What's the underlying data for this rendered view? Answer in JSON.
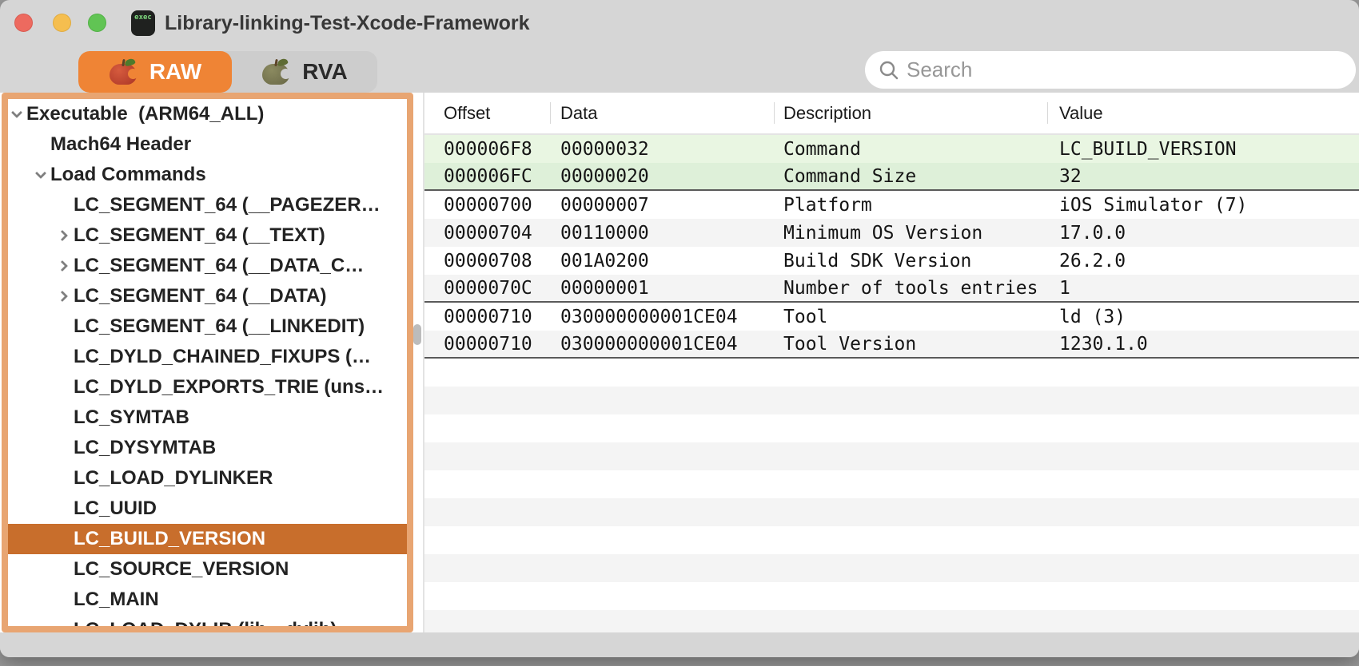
{
  "window": {
    "title": "Library-linking-Test-Xcode-Framework",
    "app_icon_text": "exec",
    "traffic_lights": [
      {
        "name": "close-button",
        "color": "#ED6A5F"
      },
      {
        "name": "minimize-button",
        "color": "#F5BE4F"
      },
      {
        "name": "zoom-button",
        "color": "#61C454"
      }
    ]
  },
  "toolbar": {
    "tabs": [
      {
        "label": "RAW",
        "icon": "apple-red-icon",
        "selected": true
      },
      {
        "label": "RVA",
        "icon": "apple-olive-icon",
        "selected": false
      }
    ],
    "search": {
      "placeholder": "Search",
      "value": ""
    }
  },
  "sidebar": {
    "items": [
      {
        "label": "Executable  (ARM64_ALL)",
        "level": 0,
        "disclosure": "open",
        "selected": false
      },
      {
        "label": "Mach64 Header",
        "level": 1,
        "disclosure": null,
        "selected": false
      },
      {
        "label": "Load Commands",
        "level": 1,
        "disclosure": "open",
        "selected": false
      },
      {
        "label": "LC_SEGMENT_64 (__PAGEZER…",
        "level": 2,
        "disclosure": null,
        "selected": false
      },
      {
        "label": "LC_SEGMENT_64 (__TEXT)",
        "level": 2,
        "disclosure": "closed",
        "selected": false
      },
      {
        "label": "LC_SEGMENT_64 (__DATA_C…",
        "level": 2,
        "disclosure": "closed",
        "selected": false
      },
      {
        "label": "LC_SEGMENT_64 (__DATA)",
        "level": 2,
        "disclosure": "closed",
        "selected": false
      },
      {
        "label": "LC_SEGMENT_64 (__LINKEDIT)",
        "level": 2,
        "disclosure": null,
        "selected": false
      },
      {
        "label": "LC_DYLD_CHAINED_FIXUPS (…",
        "level": 2,
        "disclosure": null,
        "selected": false
      },
      {
        "label": "LC_DYLD_EXPORTS_TRIE (uns…",
        "level": 2,
        "disclosure": null,
        "selected": false
      },
      {
        "label": "LC_SYMTAB",
        "level": 2,
        "disclosure": null,
        "selected": false
      },
      {
        "label": "LC_DYSYMTAB",
        "level": 2,
        "disclosure": null,
        "selected": false
      },
      {
        "label": "LC_LOAD_DYLINKER",
        "level": 2,
        "disclosure": null,
        "selected": false
      },
      {
        "label": "LC_UUID",
        "level": 2,
        "disclosure": null,
        "selected": false
      },
      {
        "label": "LC_BUILD_VERSION",
        "level": 2,
        "disclosure": null,
        "selected": true
      },
      {
        "label": "LC_SOURCE_VERSION",
        "level": 2,
        "disclosure": null,
        "selected": false
      },
      {
        "label": "LC_MAIN",
        "level": 2,
        "disclosure": null,
        "selected": false
      },
      {
        "label": "LC_LOAD_DYLIB (lib…dylib)",
        "level": 2,
        "disclosure": null,
        "selected": false,
        "clipped": true
      }
    ]
  },
  "table": {
    "columns": [
      "Offset",
      "Data",
      "Description",
      "Value"
    ],
    "rows": [
      {
        "offset": "000006F8",
        "data": "00000032",
        "description": "Command",
        "value": "LC_BUILD_VERSION",
        "tint": "green",
        "sep": false
      },
      {
        "offset": "000006FC",
        "data": "00000020",
        "description": "Command Size",
        "value": "32",
        "tint": "green",
        "sep": true
      },
      {
        "offset": "00000700",
        "data": "00000007",
        "description": "Platform",
        "value": "iOS Simulator (7)",
        "tint": null,
        "sep": false
      },
      {
        "offset": "00000704",
        "data": "00110000",
        "description": "Minimum OS Version",
        "value": "17.0.0",
        "tint": null,
        "sep": false
      },
      {
        "offset": "00000708",
        "data": "001A0200",
        "description": "Build SDK Version",
        "value": "26.2.0",
        "tint": null,
        "sep": false
      },
      {
        "offset": "0000070C",
        "data": "00000001",
        "description": "Number of tools entries",
        "value": "1",
        "tint": null,
        "sep": true
      },
      {
        "offset": "00000710",
        "data": "030000000001CE04",
        "description": "Tool",
        "value": "ld (3)",
        "tint": null,
        "sep": false
      },
      {
        "offset": "00000710",
        "data": "030000000001CE04",
        "description": "Tool Version",
        "value": "1230.1.0",
        "tint": null,
        "sep": true
      }
    ]
  },
  "colors": {
    "accent_orange": "#EF8435",
    "selection_orange": "#C86E2C",
    "sidebar_border": "#E8A572",
    "row_green_light": "#E9F6E2",
    "row_green_dark": "#DEF0D9",
    "row_stripe": "#F4F4F4",
    "chrome_gray": "#D6D6D6"
  }
}
